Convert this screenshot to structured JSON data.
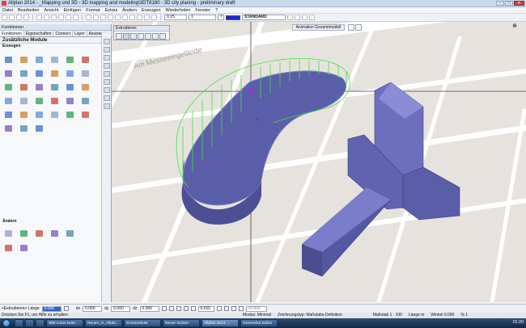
{
  "window": {
    "title": "Allplan 2014 - _Mapping und 3D - 3D mapping and modeling\\3DT8180 - 3D city planing - preliminary draft"
  },
  "menu": [
    "Datei",
    "Bearbeiten",
    "Ansicht",
    "Einfügen",
    "Format",
    "Extras",
    "Ändern",
    "Erzeugen",
    "Wiederholen",
    "Fenster",
    "?"
  ],
  "toolbar": {
    "pen": "0.25",
    "line": "1",
    "color_index": "7",
    "layer": "STANDARD",
    "swatch_color": "#1a2ad0"
  },
  "palette": {
    "header": "Funktionen",
    "tabs": [
      "Funktionen",
      "Eigenschaften",
      "Connect",
      "Layer",
      "Assistenten"
    ],
    "module": "Zusätzliche Module",
    "section_create": "Erzeugen",
    "section_modify": "Ändern"
  },
  "viewport": {
    "extrude_panel_title": "Extrudieren",
    "anim_label": "Animation  Gesamtmodell",
    "street_label": "Am Messeeingelände"
  },
  "coordbar": {
    "prompt": "<Extrudieren> Länge",
    "length_value": "0.000",
    "dx_label": "dx",
    "dx_value": "0.000",
    "dy_label": "dy",
    "dy_value": "0.000",
    "dz_label": "dz",
    "dz_value": "0.000",
    "angle": "0.010",
    "grid": "15.000"
  },
  "statusbar": {
    "help": "Drücken Sie F1, um Hilfe zu erhalten.",
    "mode": "Modus:",
    "mode_value": "Minimal",
    "drawing_type": "Zeichnungstyp:",
    "drawing_type_value": "Maßstabs-Definition",
    "scale_label": "Maßstab",
    "scale_value": "1 : 100",
    "length_label": "Länge",
    "length_value": "m",
    "angle_label": "Winkel",
    "angle_value": "0.000",
    "percent": "%",
    "percent_value": "1"
  },
  "taskbar": {
    "items": [
      "IBM Lotus Note...",
      "Neues_in_Allpla...",
      "Screenshots",
      "Neuer Ordner",
      "Allplan 2014 ...",
      "Greenshot Editor"
    ],
    "clock": "15:20"
  }
}
